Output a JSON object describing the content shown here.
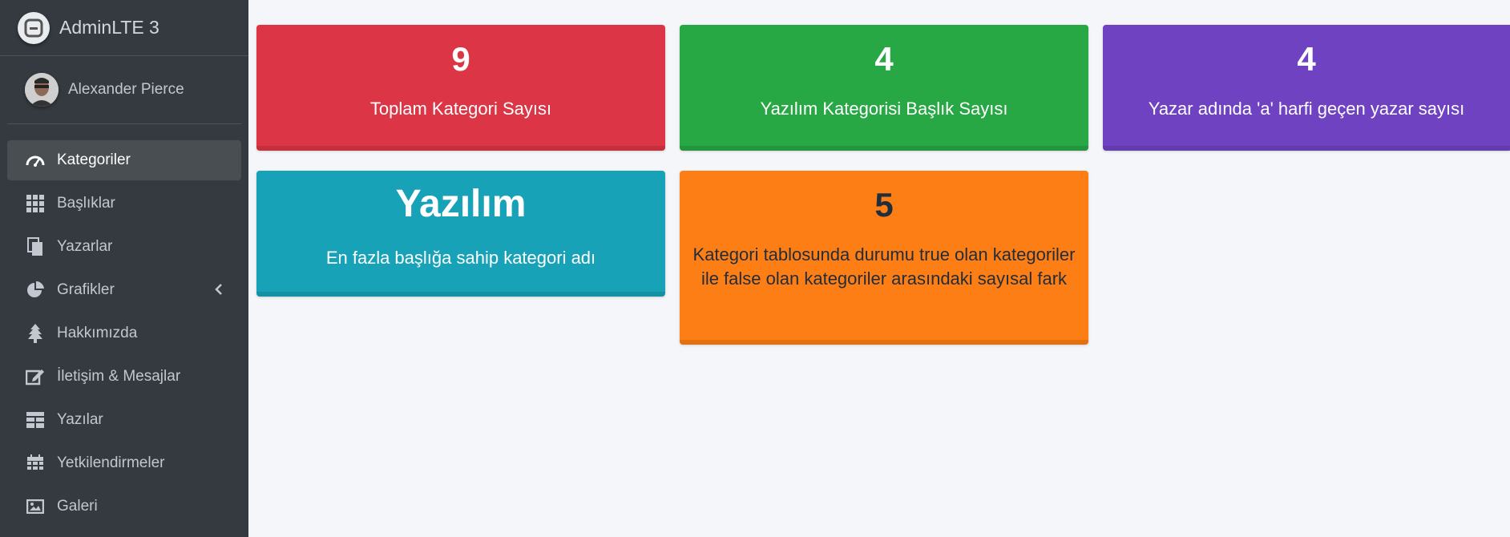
{
  "brand": {
    "title": "AdminLTE 3"
  },
  "user": {
    "name": "Alexander Pierce"
  },
  "sidebar": {
    "items": [
      {
        "label": "Kategoriler",
        "icon": "tachometer-icon",
        "active": true
      },
      {
        "label": "Başlıklar",
        "icon": "grid-icon"
      },
      {
        "label": "Yazarlar",
        "icon": "copy-icon"
      },
      {
        "label": "Grafikler",
        "icon": "pie-chart-icon",
        "expandable": true
      },
      {
        "label": "Hakkımızda",
        "icon": "tree-icon"
      },
      {
        "label": "İletişim & Mesajlar",
        "icon": "edit-icon"
      },
      {
        "label": "Yazılar",
        "icon": "table-icon"
      },
      {
        "label": "Yetkilendirmeler",
        "icon": "calendar-icon"
      },
      {
        "label": "Galeri",
        "icon": "image-icon"
      }
    ]
  },
  "stats": [
    {
      "value": "9",
      "label": "Toplam Kategori Sayısı",
      "color": "#dc3545"
    },
    {
      "value": "4",
      "label": "Yazılım Kategorisi Başlık Sayısı",
      "color": "#28a745"
    },
    {
      "value": "4",
      "label": "Yazar adında 'a' harfi geçen yazar sayısı",
      "color": "#6f42c1"
    },
    {
      "value": "Yazılım",
      "label": "En fazla başlığa sahip kategori adı",
      "color": "#17a2b8"
    },
    {
      "value": "5",
      "label": "Kategori tablosunda durumu true olan kategoriler ile false olan kategoriler arasındaki sayısal fark",
      "color": "#fd7e14"
    }
  ]
}
